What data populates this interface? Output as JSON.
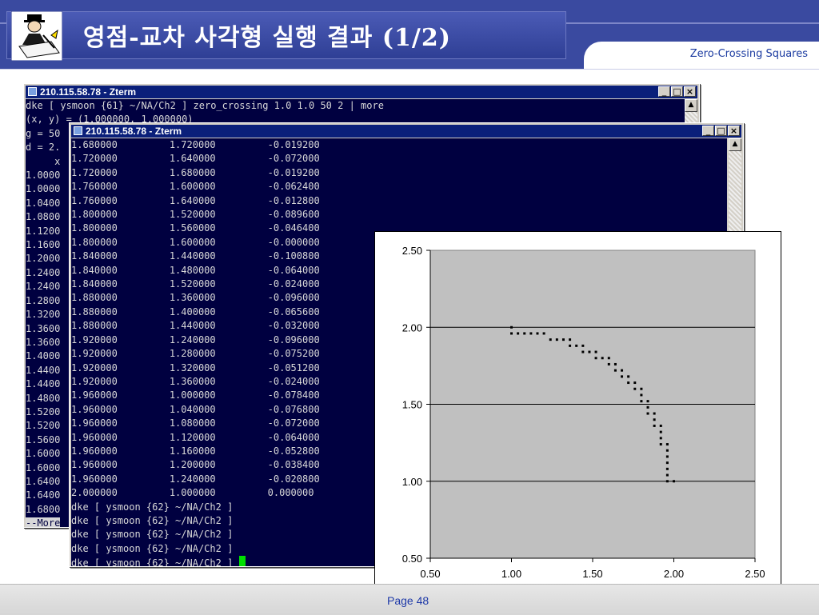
{
  "header": {
    "title": "영점-교차 사각형 실행 결과 (1/2)",
    "tab_label": "Zero-Crossing Squares",
    "logo_icon": "writer-at-desk-icon"
  },
  "footer": {
    "page": "Page 48"
  },
  "colors": {
    "header_band": "#3a4aa0",
    "terminal_bg": "#000040",
    "terminal_fg": "#d8d8d8",
    "titlebar": "#0a1f7a",
    "cursor": "#00e000",
    "plot_bg": "#c0c0c0"
  },
  "terminal_back": {
    "title": "210.115.58.78 - Zterm",
    "buttons": [
      "_",
      "□",
      "×"
    ],
    "lines": [
      "dke [ ysmoon {61} ~/NA/Ch2 ] zero_crossing 1.0 1.0 50 2 | more",
      "(x, y) = (1.000000, 1.000000)",
      "g = 50",
      "d = 2.",
      "     x",
      "1.0000",
      "1.0000",
      "1.0400",
      "1.0800",
      "1.1200",
      "1.1600",
      "1.2000",
      "1.2400",
      "1.2400",
      "1.2800",
      "1.3200",
      "1.3600",
      "1.3600",
      "1.4000",
      "1.4400",
      "1.4400",
      "1.4800",
      "1.5200",
      "1.5200",
      "1.5600",
      "1.6000",
      "1.6000",
      "1.6400",
      "1.6400",
      "1.6800"
    ],
    "more_prompt": "--More"
  },
  "terminal_front": {
    "title": "210.115.58.78 - Zterm",
    "buttons": [
      "_",
      "□",
      "×"
    ],
    "rows": [
      [
        "1.680000",
        "1.720000",
        "-0.019200"
      ],
      [
        "1.720000",
        "1.640000",
        "-0.072000"
      ],
      [
        "1.720000",
        "1.680000",
        "-0.019200"
      ],
      [
        "1.760000",
        "1.600000",
        "-0.062400"
      ],
      [
        "1.760000",
        "1.640000",
        "-0.012800"
      ],
      [
        "1.800000",
        "1.520000",
        "-0.089600"
      ],
      [
        "1.800000",
        "1.560000",
        "-0.046400"
      ],
      [
        "1.800000",
        "1.600000",
        "-0.000000"
      ],
      [
        "1.840000",
        "1.440000",
        "-0.100800"
      ],
      [
        "1.840000",
        "1.480000",
        "-0.064000"
      ],
      [
        "1.840000",
        "1.520000",
        "-0.024000"
      ],
      [
        "1.880000",
        "1.360000",
        "-0.096000"
      ],
      [
        "1.880000",
        "1.400000",
        "-0.065600"
      ],
      [
        "1.880000",
        "1.440000",
        "-0.032000"
      ],
      [
        "1.920000",
        "1.240000",
        "-0.096000"
      ],
      [
        "1.920000",
        "1.280000",
        "-0.075200"
      ],
      [
        "1.920000",
        "1.320000",
        "-0.051200"
      ],
      [
        "1.920000",
        "1.360000",
        "-0.024000"
      ],
      [
        "1.960000",
        "1.000000",
        "-0.078400"
      ],
      [
        "1.960000",
        "1.040000",
        "-0.076800"
      ],
      [
        "1.960000",
        "1.080000",
        "-0.072000"
      ],
      [
        "1.960000",
        "1.120000",
        "-0.064000"
      ],
      [
        "1.960000",
        "1.160000",
        "-0.052800"
      ],
      [
        "1.960000",
        "1.200000",
        "-0.038400"
      ],
      [
        "1.960000",
        "1.240000",
        "-0.020800"
      ],
      [
        "2.000000",
        "1.000000",
        "0.000000"
      ]
    ],
    "prompts": [
      "dke [ ysmoon {62} ~/NA/Ch2 ]",
      "dke [ ysmoon {62} ~/NA/Ch2 ]",
      "dke [ ysmoon {62} ~/NA/Ch2 ]",
      "dke [ ysmoon {62} ~/NA/Ch2 ]",
      "dke [ ysmoon {62} ~/NA/Ch2 ] "
    ]
  },
  "chart_data": {
    "type": "scatter",
    "title": "",
    "xlabel": "",
    "ylabel": "",
    "xlim": [
      0.5,
      2.5
    ],
    "ylim": [
      0.5,
      2.5
    ],
    "xticks": [
      "0.50",
      "1.00",
      "1.50",
      "2.00",
      "2.50"
    ],
    "yticks": [
      "0.50",
      "1.00",
      "1.50",
      "2.00",
      "2.50"
    ],
    "grid": "horizontal",
    "plot_background": "#c0c0c0",
    "series": [
      {
        "points": [
          [
            1.0,
            2.0
          ],
          [
            1.0,
            1.96
          ],
          [
            1.04,
            1.96
          ],
          [
            1.08,
            1.96
          ],
          [
            1.12,
            1.96
          ],
          [
            1.16,
            1.96
          ],
          [
            1.2,
            1.96
          ],
          [
            1.24,
            1.92
          ],
          [
            1.28,
            1.92
          ],
          [
            1.32,
            1.92
          ],
          [
            1.36,
            1.92
          ],
          [
            1.36,
            1.88
          ],
          [
            1.4,
            1.88
          ],
          [
            1.44,
            1.88
          ],
          [
            1.44,
            1.84
          ],
          [
            1.48,
            1.84
          ],
          [
            1.52,
            1.84
          ],
          [
            1.52,
            1.8
          ],
          [
            1.56,
            1.8
          ],
          [
            1.6,
            1.8
          ],
          [
            1.6,
            1.76
          ],
          [
            1.64,
            1.76
          ],
          [
            1.64,
            1.72
          ],
          [
            1.68,
            1.72
          ],
          [
            1.68,
            1.68
          ],
          [
            1.72,
            1.68
          ],
          [
            1.72,
            1.64
          ],
          [
            1.76,
            1.64
          ],
          [
            1.76,
            1.6
          ],
          [
            1.8,
            1.6
          ],
          [
            1.8,
            1.56
          ],
          [
            1.8,
            1.52
          ],
          [
            1.84,
            1.52
          ],
          [
            1.84,
            1.48
          ],
          [
            1.84,
            1.44
          ],
          [
            1.88,
            1.44
          ],
          [
            1.88,
            1.4
          ],
          [
            1.88,
            1.36
          ],
          [
            1.92,
            1.36
          ],
          [
            1.92,
            1.32
          ],
          [
            1.92,
            1.28
          ],
          [
            1.92,
            1.24
          ],
          [
            1.96,
            1.24
          ],
          [
            1.96,
            1.2
          ],
          [
            1.96,
            1.16
          ],
          [
            1.96,
            1.12
          ],
          [
            1.96,
            1.08
          ],
          [
            1.96,
            1.04
          ],
          [
            1.96,
            1.0
          ],
          [
            2.0,
            1.0
          ]
        ]
      }
    ]
  }
}
